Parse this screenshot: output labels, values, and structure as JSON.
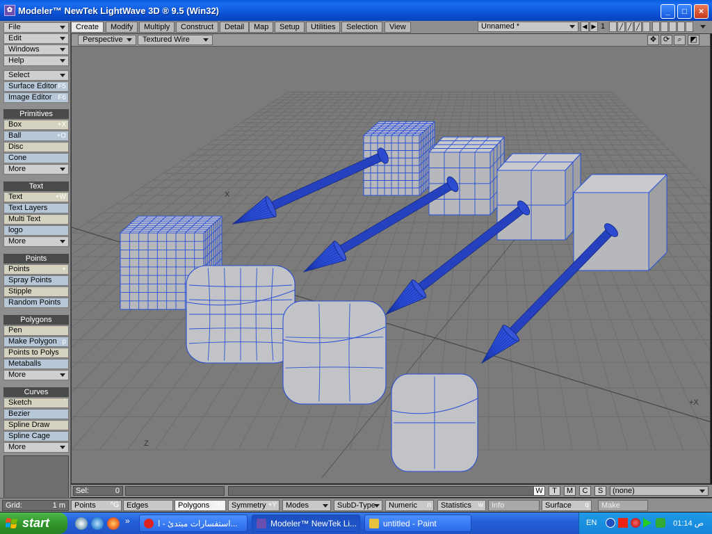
{
  "window": {
    "title": "Modeler™ NewTek LightWave 3D ® 9.5  (Win32)",
    "icon": "lightwave-icon",
    "controls": [
      "minimize",
      "maximize",
      "close"
    ]
  },
  "left_panel": {
    "top_menus": [
      {
        "label": "File"
      },
      {
        "label": "Edit"
      },
      {
        "label": "Windows"
      },
      {
        "label": "Help"
      }
    ],
    "select_menu": "Select",
    "editors": [
      {
        "label": "Surface Editor",
        "shortcut": "F5"
      },
      {
        "label": "Image Editor",
        "shortcut": "F6"
      }
    ],
    "groups": [
      {
        "title": "Primitives",
        "items": [
          {
            "label": "Box",
            "shortcut": "+X"
          },
          {
            "label": "Ball",
            "shortcut": "+O"
          },
          {
            "label": "Disc",
            "shortcut": ""
          },
          {
            "label": "Cone",
            "shortcut": ""
          },
          {
            "label": "More",
            "shortcut": ""
          }
        ]
      },
      {
        "title": "Text",
        "items": [
          {
            "label": "Text",
            "shortcut": "+W"
          },
          {
            "label": "Text Layers",
            "shortcut": ""
          },
          {
            "label": "Multi Text",
            "shortcut": ""
          },
          {
            "label": "logo",
            "shortcut": ""
          },
          {
            "label": "More",
            "shortcut": ""
          }
        ]
      },
      {
        "title": "Points",
        "items": [
          {
            "label": "Points",
            "shortcut": "+"
          },
          {
            "label": "Spray Points",
            "shortcut": ""
          },
          {
            "label": "Stipple",
            "shortcut": ""
          },
          {
            "label": "Random Points",
            "shortcut": ""
          }
        ]
      },
      {
        "title": "Polygons",
        "items": [
          {
            "label": "Pen",
            "shortcut": ""
          },
          {
            "label": "Make Polygon",
            "shortcut": "p"
          },
          {
            "label": "Points to Polys",
            "shortcut": ""
          },
          {
            "label": "Metaballs",
            "shortcut": ""
          },
          {
            "label": "More",
            "shortcut": ""
          }
        ]
      },
      {
        "title": "Curves",
        "items": [
          {
            "label": "Sketch",
            "shortcut": "`"
          },
          {
            "label": "Bezier",
            "shortcut": ""
          },
          {
            "label": "Spline Draw",
            "shortcut": ""
          },
          {
            "label": "Spline Cage",
            "shortcut": ""
          },
          {
            "label": "More",
            "shortcut": ""
          }
        ]
      }
    ]
  },
  "tabs": [
    {
      "label": "Create",
      "active": true
    },
    {
      "label": "Modify"
    },
    {
      "label": "Multiply"
    },
    {
      "label": "Construct"
    },
    {
      "label": "Detail"
    },
    {
      "label": "Map"
    },
    {
      "label": "Setup"
    },
    {
      "label": "Utilities"
    },
    {
      "label": "Selection"
    },
    {
      "label": "View"
    }
  ],
  "document": {
    "name": "Unnamed *",
    "layer": "1"
  },
  "viewport": {
    "view": "Perspective",
    "render_mode": "Textured Wire",
    "icons": [
      "move-icon",
      "rotate-icon",
      "zoom-icon",
      "maximize-viewport-icon"
    ],
    "axis_labels": {
      "x_neg": "X",
      "x_pos": "+X",
      "z": "Z"
    },
    "mesh_color": "#2a4fd6",
    "surface_color": "#b9bbbf"
  },
  "sel_bar": {
    "label": "Sel:",
    "value": "0",
    "wtmcs": [
      "W",
      "T",
      "M",
      "C",
      "S"
    ],
    "surface": "(none)"
  },
  "mode_bar": {
    "grid_label": "Grid:",
    "grid_value": "1 m",
    "buttons": [
      {
        "label": "Points",
        "shortcut": "^G"
      },
      {
        "label": "Edges",
        "shortcut": ""
      },
      {
        "label": "Polygons",
        "shortcut": "^H",
        "active": true
      },
      {
        "label": "Symmetry",
        "shortcut": "+Y"
      },
      {
        "label": "Modes",
        "dropdown": true
      },
      {
        "label": "SubD-Type",
        "dropdown": true
      },
      {
        "label": "Numeric",
        "shortcut": "n"
      },
      {
        "label": "Statistics",
        "shortcut": "w"
      },
      {
        "label": "Info",
        "dim": true
      },
      {
        "label": "Surface",
        "shortcut": "q"
      },
      {
        "label": "Make",
        "dim": true
      }
    ]
  },
  "taskbar": {
    "start": "start",
    "tasks": [
      {
        "label": "استفسارات مبتدئ - ا...",
        "icon": "opera-icon"
      },
      {
        "label": "Modeler™ NewTek Li...",
        "icon": "lightwave-icon",
        "active": true
      },
      {
        "label": "untitled - Paint",
        "icon": "paint-icon"
      }
    ],
    "language": "EN",
    "clock": "01:14 ص"
  }
}
